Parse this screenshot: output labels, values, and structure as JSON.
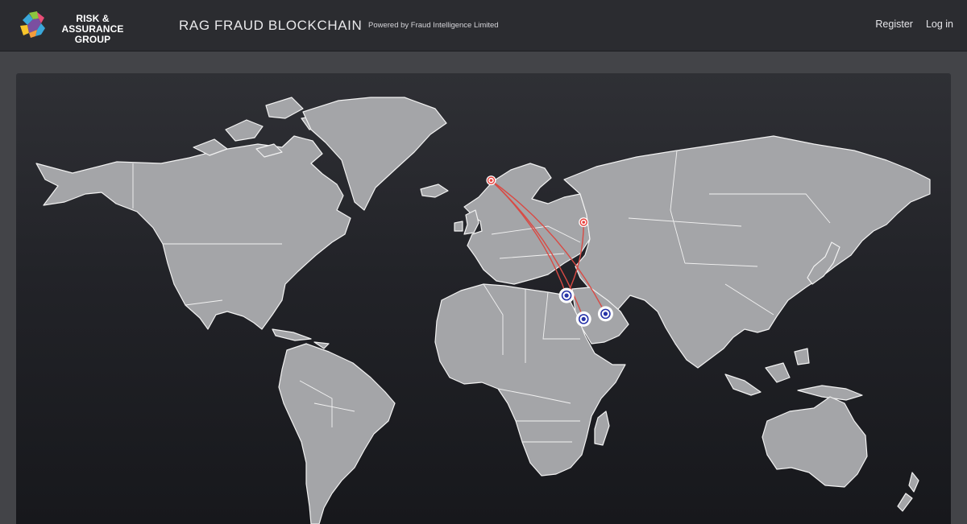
{
  "brand": {
    "logo_text_line1": "RISK & ASSURANCE",
    "logo_text_line2": "GROUP",
    "logo_colors": [
      "#3aa7d9",
      "#8cc63f",
      "#f7c52b",
      "#e94e77",
      "#7b4fa0"
    ]
  },
  "header": {
    "title": "RAG FRAUD BLOCKCHAIN",
    "powered_by": "Powered by Fraud Intelligence Limited",
    "nav": {
      "register": "Register",
      "login": "Log in"
    }
  },
  "map": {
    "type": "world map",
    "land_color": "#a4a5a8",
    "border_color": "#f2f2f2",
    "route_color": "#d94a44",
    "origin_marker_color": "#e8413c",
    "destination_marker_color": "#2733a8",
    "origins": [
      {
        "name": "origin-uk-marker",
        "lon": -1.5,
        "lat": 53.5
      },
      {
        "name": "origin-turkey-marker",
        "lon": 36.5,
        "lat": 37.5
      }
    ],
    "destinations": [
      {
        "name": "destination-south-sudan-marker",
        "lon": 29.5,
        "lat": 9.5
      },
      {
        "name": "destination-kenya-marker",
        "lon": 36.5,
        "lat": 0.5
      },
      {
        "name": "destination-somalia-marker",
        "lon": 45.5,
        "lat": 2.5
      }
    ],
    "routes": [
      {
        "from": 0,
        "to": 0
      },
      {
        "from": 0,
        "to": 1
      },
      {
        "from": 0,
        "to": 2
      },
      {
        "from": 1,
        "to": 0
      }
    ]
  }
}
